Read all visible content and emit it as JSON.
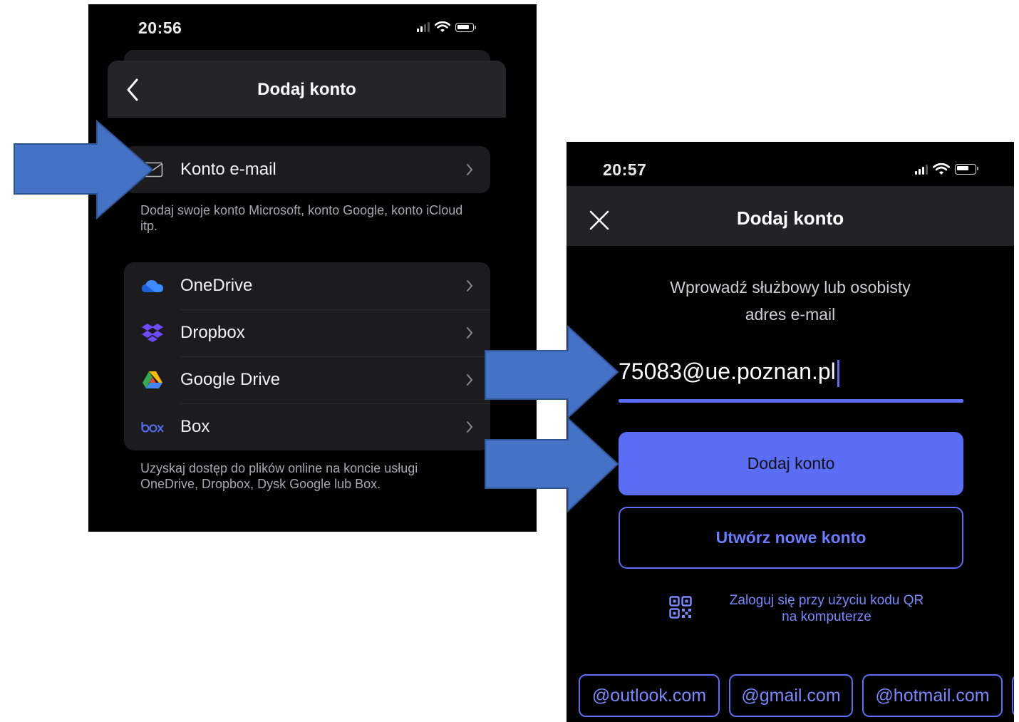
{
  "left_screen": {
    "status": {
      "time": "20:56"
    },
    "header": {
      "title": "Dodaj konto"
    },
    "email_section": {
      "items": [
        {
          "label": "Konto e-mail",
          "icon": "envelope-icon"
        }
      ],
      "footer": "Dodaj swoje konto Microsoft, konto Google, konto iCloud itp."
    },
    "storage_section": {
      "items": [
        {
          "label": "OneDrive",
          "icon": "onedrive-icon"
        },
        {
          "label": "Dropbox",
          "icon": "dropbox-icon"
        },
        {
          "label": "Google Drive",
          "icon": "google-drive-icon"
        },
        {
          "label": "Box",
          "icon": "box-icon"
        }
      ],
      "footer": "Uzyskaj dostęp do plików online na koncie usługi OneDrive, Dropbox, Dysk Google lub Box."
    }
  },
  "right_screen": {
    "status": {
      "time": "20:57"
    },
    "header": {
      "title": "Dodaj konto"
    },
    "prompt_line1": "Wprowadź służbowy lub osobisty",
    "prompt_line2": "adres e-mail",
    "email_value": "75083@ue.poznan.pl",
    "add_button": "Dodaj konto",
    "create_button": "Utwórz nowe konto",
    "qr_line1": "Zaloguj się przy użyciu kodu QR",
    "qr_line2": "na komputerze",
    "domain_chips": [
      "@outlook.com",
      "@gmail.com",
      "@hotmail.com"
    ]
  },
  "colors": {
    "accent": "#5b6cf5",
    "annotation_arrow": "#4472c4",
    "annotation_arrow_border": "#2f5597"
  }
}
